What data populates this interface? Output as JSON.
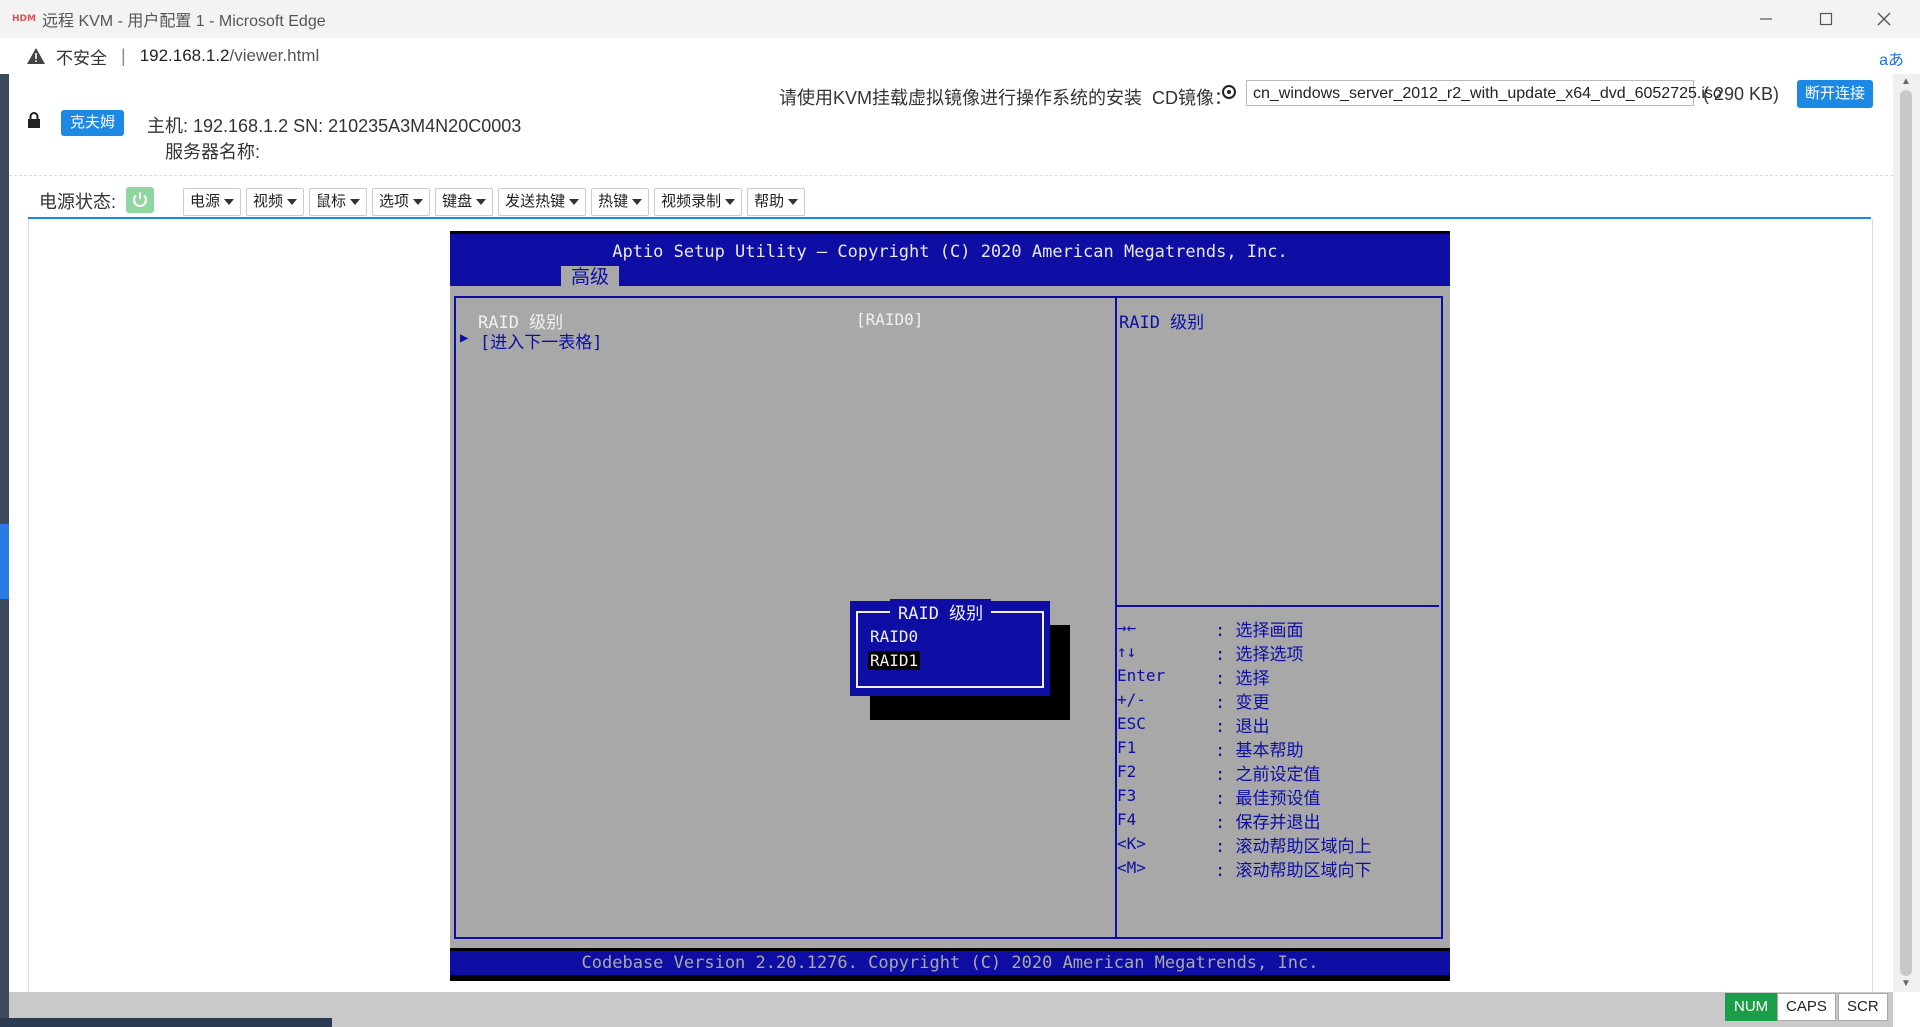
{
  "window": {
    "app_icon_text": "HDM",
    "title": "远程 KVM - 用户配置 1 - Microsoft Edge"
  },
  "address_bar": {
    "security_label": "不安全",
    "separator": "|",
    "host": "192.168.1.2",
    "path": "/viewer.html",
    "reader_icon": "aあ"
  },
  "header": {
    "user_button": "克夫姆",
    "host_line": "主机:   192.168.1.2 SN:   210235A3M4N20C0003",
    "server_name_label": "服务器名称:",
    "notice": "请使用KVM挂载虚拟镜像进行操作系统的安装",
    "cd_label": "CD镜像：",
    "cd_file": "cn_windows_server_2012_r2_with_update_x64_dvd_6052725.iso",
    "cd_size": "( 290 KB)",
    "disconnect_button": "断开连接"
  },
  "toolbar": {
    "power_label": "电源状态:",
    "menus": [
      "电源",
      "视频",
      "鼠标",
      "选项",
      "键盘",
      "发送热键",
      "热键",
      "视频录制",
      "帮助"
    ]
  },
  "bios": {
    "title": "Aptio Setup Utility – Copyright (C) 2020 American Megatrends, Inc.",
    "active_tab": "高级",
    "items": [
      {
        "label": "RAID 级别",
        "value": "[RAID0]"
      },
      {
        "label": "[进入下一表格]",
        "marker": "▶"
      }
    ],
    "help_title": "RAID 级别",
    "popup": {
      "title": "RAID 级别",
      "options": [
        "RAID0",
        "RAID1"
      ],
      "selected": "RAID1"
    },
    "key_help": [
      {
        "key": "→←",
        "desc": ": 选择画面"
      },
      {
        "key": "↑↓",
        "desc": ": 选择选项"
      },
      {
        "key": "Enter",
        "desc": ": 选择"
      },
      {
        "key": "+/-",
        "desc": ": 变更"
      },
      {
        "key": "ESC",
        "desc": ": 退出"
      },
      {
        "key": "F1",
        "desc": ": 基本帮助"
      },
      {
        "key": "F2",
        "desc": ": 之前设定值"
      },
      {
        "key": "F3",
        "desc": ": 最佳预设值"
      },
      {
        "key": "F4",
        "desc": ": 保存并退出"
      },
      {
        "key": "<K>",
        "desc": ": 滚动帮助区域向上"
      },
      {
        "key": "<M>",
        "desc": ": 滚动帮助区域向下"
      }
    ],
    "footer": "Codebase Version 2.20.1276. Copyright (C) 2020 American Megatrends, Inc."
  },
  "status": {
    "indicators": [
      "NUM",
      "CAPS",
      "SCR"
    ],
    "active": "NUM"
  },
  "colors": {
    "bios_blue": "#0e0ea4",
    "bios_gray": "#a8a8a8",
    "accent": "#1e88e5",
    "num_on": "#1a9e47"
  }
}
